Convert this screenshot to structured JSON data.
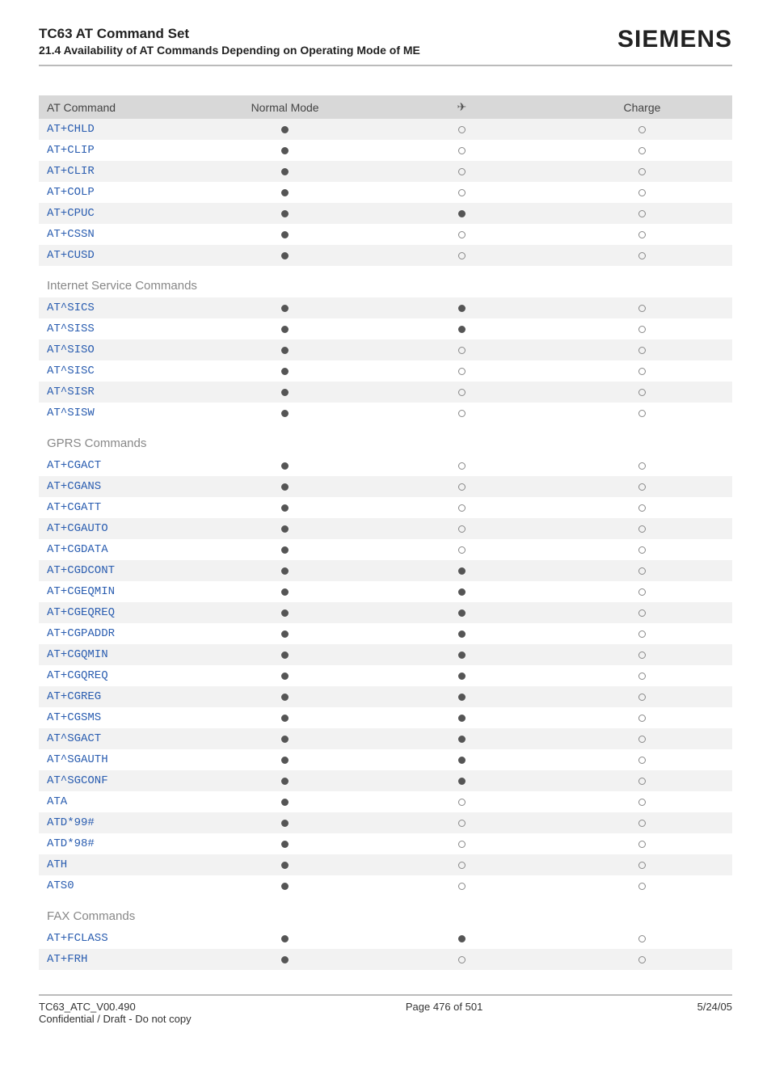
{
  "header": {
    "title": "TC63 AT Command Set",
    "subtitle": "21.4 Availability of AT Commands Depending on Operating Mode of ME",
    "brand": "SIEMENS"
  },
  "table": {
    "columns": [
      "AT Command",
      "Normal Mode",
      "airplane",
      "Charge"
    ],
    "airplane_glyph": "✈",
    "rows": [
      {
        "cmd": "AT+CHLD",
        "normal": "filled",
        "air": "empty",
        "charge": "empty"
      },
      {
        "cmd": "AT+CLIP",
        "normal": "filled",
        "air": "empty",
        "charge": "empty"
      },
      {
        "cmd": "AT+CLIR",
        "normal": "filled",
        "air": "empty",
        "charge": "empty"
      },
      {
        "cmd": "AT+COLP",
        "normal": "filled",
        "air": "empty",
        "charge": "empty"
      },
      {
        "cmd": "AT+CPUC",
        "normal": "filled",
        "air": "filled",
        "charge": "empty"
      },
      {
        "cmd": "AT+CSSN",
        "normal": "filled",
        "air": "empty",
        "charge": "empty"
      },
      {
        "cmd": "AT+CUSD",
        "normal": "filled",
        "air": "empty",
        "charge": "empty"
      }
    ],
    "sections": [
      {
        "title": "Internet Service Commands",
        "rows": [
          {
            "cmd": "AT^SICS",
            "normal": "filled",
            "air": "filled",
            "charge": "empty"
          },
          {
            "cmd": "AT^SISS",
            "normal": "filled",
            "air": "filled",
            "charge": "empty"
          },
          {
            "cmd": "AT^SISO",
            "normal": "filled",
            "air": "empty",
            "charge": "empty"
          },
          {
            "cmd": "AT^SISC",
            "normal": "filled",
            "air": "empty",
            "charge": "empty"
          },
          {
            "cmd": "AT^SISR",
            "normal": "filled",
            "air": "empty",
            "charge": "empty"
          },
          {
            "cmd": "AT^SISW",
            "normal": "filled",
            "air": "empty",
            "charge": "empty"
          }
        ]
      },
      {
        "title": "GPRS Commands",
        "rows": [
          {
            "cmd": "AT+CGACT",
            "normal": "filled",
            "air": "empty",
            "charge": "empty"
          },
          {
            "cmd": "AT+CGANS",
            "normal": "filled",
            "air": "empty",
            "charge": "empty"
          },
          {
            "cmd": "AT+CGATT",
            "normal": "filled",
            "air": "empty",
            "charge": "empty"
          },
          {
            "cmd": "AT+CGAUTO",
            "normal": "filled",
            "air": "empty",
            "charge": "empty"
          },
          {
            "cmd": "AT+CGDATA",
            "normal": "filled",
            "air": "empty",
            "charge": "empty"
          },
          {
            "cmd": "AT+CGDCONT",
            "normal": "filled",
            "air": "filled",
            "charge": "empty"
          },
          {
            "cmd": "AT+CGEQMIN",
            "normal": "filled",
            "air": "filled",
            "charge": "empty"
          },
          {
            "cmd": "AT+CGEQREQ",
            "normal": "filled",
            "air": "filled",
            "charge": "empty"
          },
          {
            "cmd": "AT+CGPADDR",
            "normal": "filled",
            "air": "filled",
            "charge": "empty"
          },
          {
            "cmd": "AT+CGQMIN",
            "normal": "filled",
            "air": "filled",
            "charge": "empty"
          },
          {
            "cmd": "AT+CGQREQ",
            "normal": "filled",
            "air": "filled",
            "charge": "empty"
          },
          {
            "cmd": "AT+CGREG",
            "normal": "filled",
            "air": "filled",
            "charge": "empty"
          },
          {
            "cmd": "AT+CGSMS",
            "normal": "filled",
            "air": "filled",
            "charge": "empty"
          },
          {
            "cmd": "AT^SGACT",
            "normal": "filled",
            "air": "filled",
            "charge": "empty"
          },
          {
            "cmd": "AT^SGAUTH",
            "normal": "filled",
            "air": "filled",
            "charge": "empty"
          },
          {
            "cmd": "AT^SGCONF",
            "normal": "filled",
            "air": "filled",
            "charge": "empty"
          },
          {
            "cmd": "ATA",
            "normal": "filled",
            "air": "empty",
            "charge": "empty"
          },
          {
            "cmd": "ATD*99#",
            "normal": "filled",
            "air": "empty",
            "charge": "empty"
          },
          {
            "cmd": "ATD*98#",
            "normal": "filled",
            "air": "empty",
            "charge": "empty"
          },
          {
            "cmd": "ATH",
            "normal": "filled",
            "air": "empty",
            "charge": "empty"
          },
          {
            "cmd": "ATS0",
            "normal": "filled",
            "air": "empty",
            "charge": "empty"
          }
        ]
      },
      {
        "title": "FAX Commands",
        "rows": [
          {
            "cmd": "AT+FCLASS",
            "normal": "filled",
            "air": "filled",
            "charge": "empty"
          },
          {
            "cmd": "AT+FRH",
            "normal": "filled",
            "air": "empty",
            "charge": "empty"
          }
        ]
      }
    ]
  },
  "footer": {
    "left1": "TC63_ATC_V00.490",
    "left2": "Confidential / Draft - Do not copy",
    "center": "Page 476 of 501",
    "right": "5/24/05"
  }
}
